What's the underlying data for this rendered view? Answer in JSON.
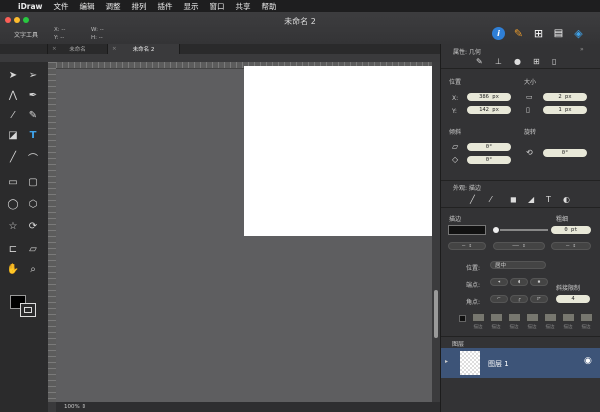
{
  "menubar": {
    "apple": "",
    "items": [
      "iDraw",
      "文件",
      "编辑",
      "调整",
      "排列",
      "插件",
      "显示",
      "窗口",
      "共享",
      "帮助"
    ]
  },
  "window": {
    "title": "未命名 2"
  },
  "toolbar": {
    "tool_name": "文字工具",
    "x_label": "X:",
    "x_value": "--",
    "y_label": "Y:",
    "y_value": "--",
    "w_label": "W:",
    "w_value": "--",
    "h_label": "H:",
    "h_value": "--"
  },
  "tabs": [
    {
      "label": "未命名"
    },
    {
      "label": "未命名 2"
    }
  ],
  "status": {
    "zoom": "100%"
  },
  "panel": {
    "header": "属性: 几何",
    "position_label": "位置",
    "size_label": "大小",
    "x_label": "X:",
    "x_value": "386 px",
    "y_label": "Y:",
    "y_value": "142 px",
    "w_value": "2 px",
    "h_value": "1 px",
    "skew_label": "倾斜",
    "rotate_label": "旋转",
    "skew_h": "0°",
    "skew_v": "0°",
    "rotate_value": "0°",
    "appearance_header": "外观: 描边",
    "stroke_label": "描边",
    "thickness_label": "粗细",
    "thickness_value": "0 pt",
    "position_field_label": "位置:",
    "position_value": "居中",
    "endpoint_label": "端点:",
    "corner_label": "角点:",
    "miter_label": "斜接限制",
    "miter_value": "4",
    "swatch_labels": [
      "描边",
      "描边",
      "描边",
      "描边",
      "描边",
      "描边",
      "描边"
    ],
    "layers_header": "图层",
    "layer_name": "图层 1"
  },
  "colors": {
    "accent": "#3d5478",
    "page": "#ffffff",
    "canvas": "#5e5e60"
  }
}
